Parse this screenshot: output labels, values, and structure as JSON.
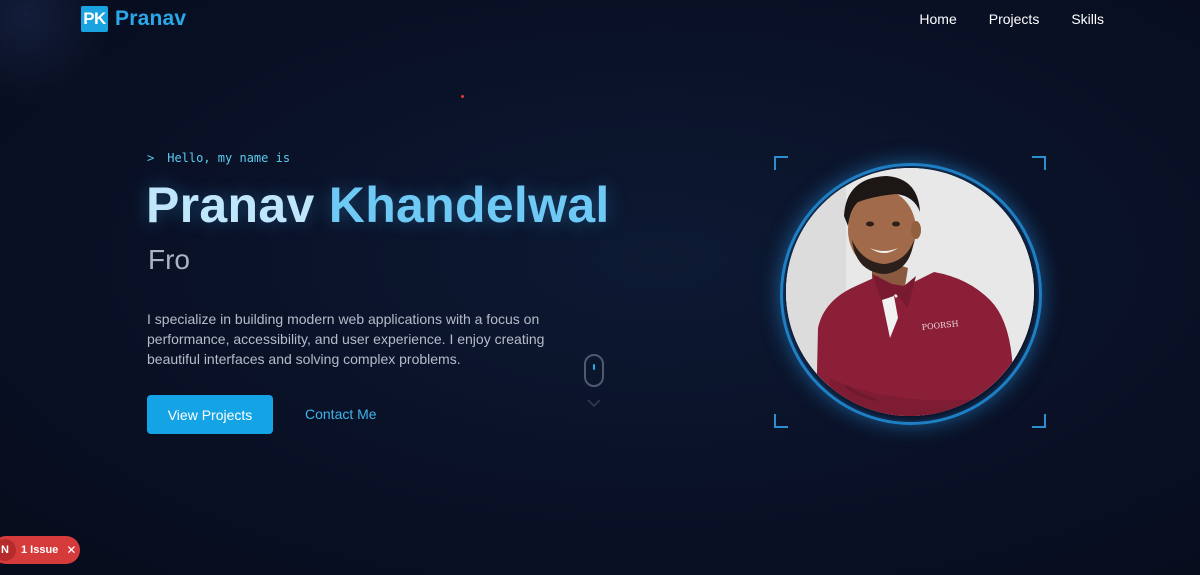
{
  "nav": {
    "logo_badge": "PK",
    "logo_text": "Pranav",
    "items": [
      "Home",
      "Projects",
      "Skills"
    ]
  },
  "hero": {
    "prompt": ">",
    "greeting": "Hello, my name is",
    "first_name": "Pranav",
    "last_name": "Khandelwal",
    "role_typing": "Fro",
    "description": "I specialize in building modern web applications with a focus on performance, accessibility, and user experience. I enjoy creating beautiful interfaces and solving complex problems.",
    "primary_button": "View Projects",
    "secondary_button": "Contact Me"
  },
  "overlay": {
    "issue_label": "1 Issue",
    "close_symbol": "✕"
  },
  "colors": {
    "accent": "#14a4e6",
    "background": "#0a1228",
    "issue_red": "#d63b3b"
  }
}
